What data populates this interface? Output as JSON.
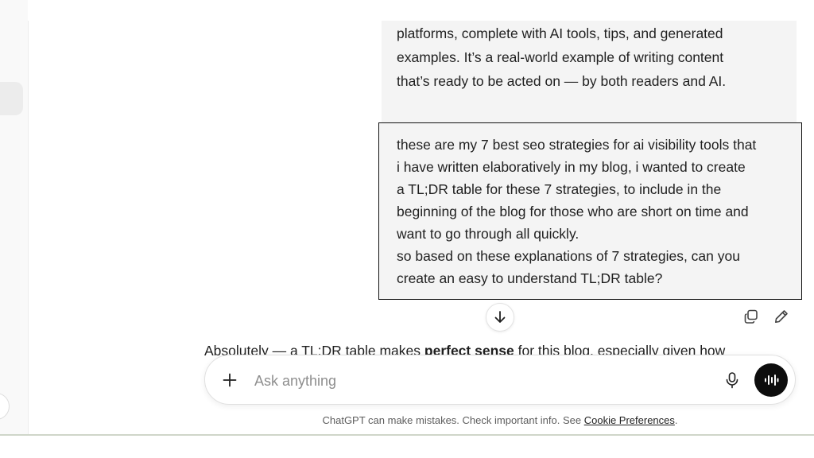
{
  "conversation": {
    "previous_message_lines": [
      "platforms, complete with AI tools, tips, and generated",
      "examples. It’s a real-world example of writing content",
      "that’s ready to be acted on — by both readers and AI."
    ],
    "current_message_lines": [
      "these are my 7 best seo strategies for ai visibility tools that",
      "i have written elaboratively in my blog, i wanted to create",
      "a TL;DR table for these 7 strategies, to include in the",
      "beginning of the blog for those who are short on time and",
      "want to go through all quickly.",
      "so based on these explanations of 7 strategies, can you",
      "create an easy to understand TL;DR table?"
    ],
    "reply_preview": {
      "part1": "Absolutely — a TL;DR table makes ",
      "bold": "perfect sense",
      "part2": " for this blog, especially given how"
    }
  },
  "composer": {
    "placeholder": "Ask anything"
  },
  "footer": {
    "disclaimer_text": "ChatGPT can make mistakes. Check important info. See ",
    "link_text": "Cookie Preferences",
    "trailing": "."
  },
  "icons": {
    "scroll_down": "arrow-down-icon",
    "copy": "copy-icon",
    "edit": "pencil-icon",
    "plus": "plus-icon",
    "mic": "microphone-icon",
    "voice": "voice-waveform-icon"
  },
  "colors": {
    "bubble_bg": "#f4f4f4",
    "voice_button": "#0d0d0d",
    "text": "#1f1f1f"
  }
}
